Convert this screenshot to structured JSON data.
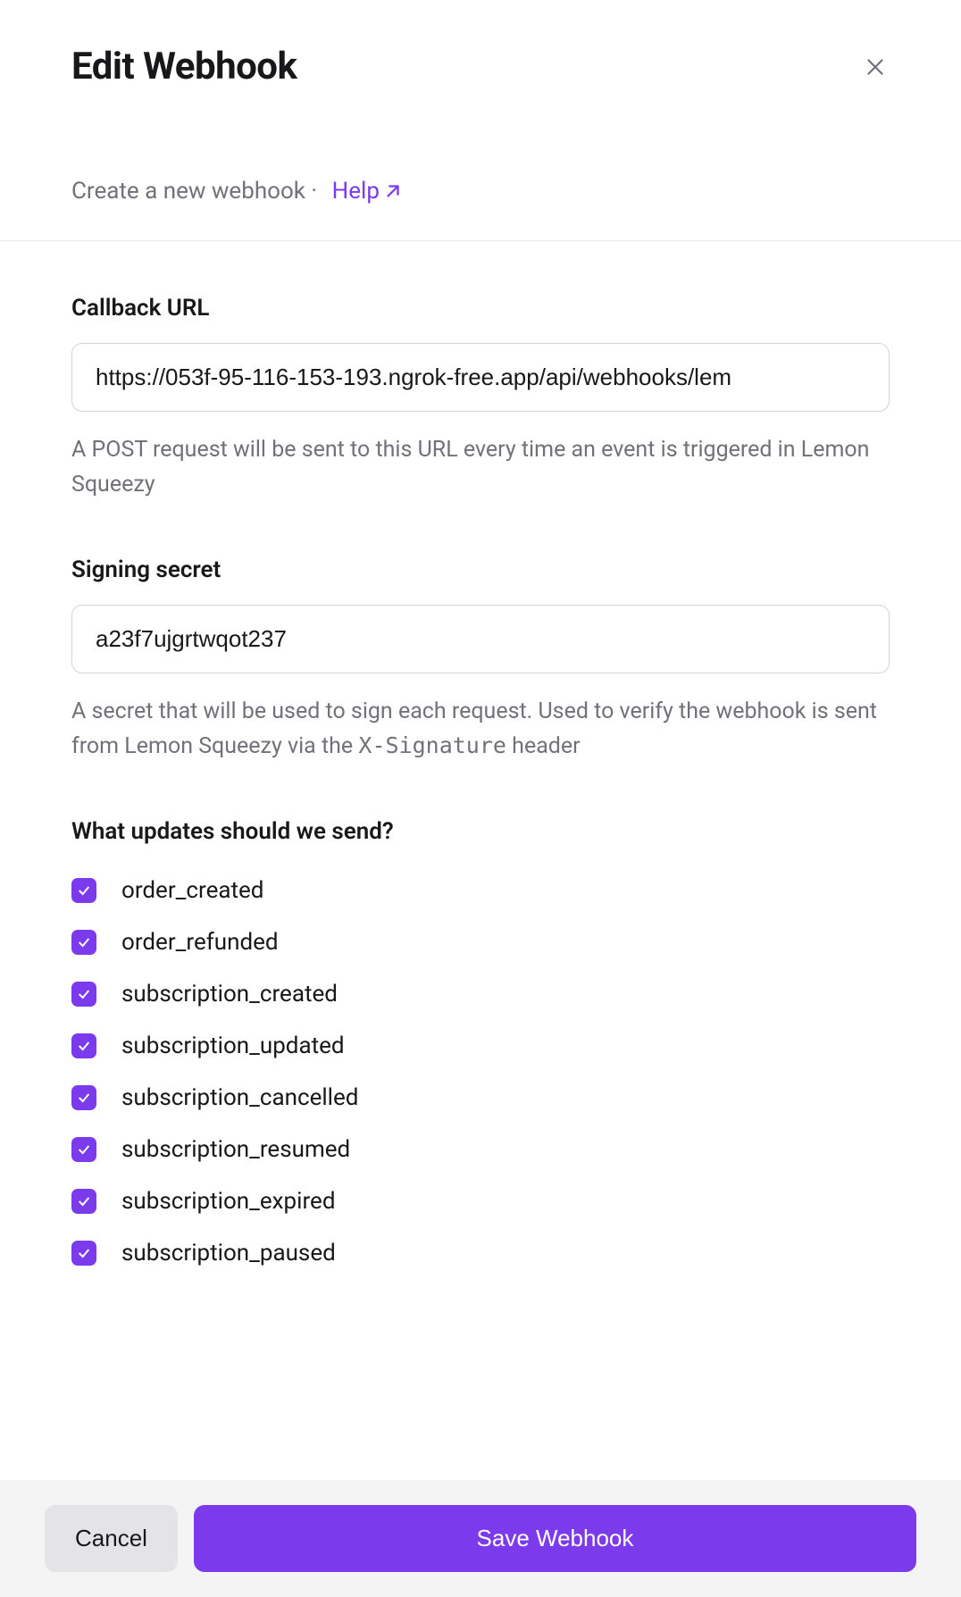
{
  "header": {
    "title": "Edit Webhook",
    "subtitle_prefix": "Create a new webhook",
    "help_label": "Help"
  },
  "fields": {
    "callback_url": {
      "label": "Callback URL",
      "value": "https://053f-95-116-153-193.ngrok-free.app/api/webhooks/lem",
      "help": "A POST request will be sent to this URL every time an event is triggered in Lemon Squeezy"
    },
    "signing_secret": {
      "label": "Signing secret",
      "value": "a23f7ujgrtwqot237",
      "help_prefix": "A secret that will be used to sign each request. Used to verify the webhook is sent from Lemon Squeezy via the ",
      "help_code": "X-Signature",
      "help_suffix": " header"
    }
  },
  "events": {
    "label": "What updates should we send?",
    "items": [
      {
        "name": "order_created",
        "checked": true
      },
      {
        "name": "order_refunded",
        "checked": true
      },
      {
        "name": "subscription_created",
        "checked": true
      },
      {
        "name": "subscription_updated",
        "checked": true
      },
      {
        "name": "subscription_cancelled",
        "checked": true
      },
      {
        "name": "subscription_resumed",
        "checked": true
      },
      {
        "name": "subscription_expired",
        "checked": true
      },
      {
        "name": "subscription_paused",
        "checked": true
      }
    ]
  },
  "footer": {
    "cancel_label": "Cancel",
    "save_label": "Save Webhook"
  },
  "colors": {
    "accent": "#7c3aed",
    "text": "#18181b",
    "muted": "#71717a"
  }
}
